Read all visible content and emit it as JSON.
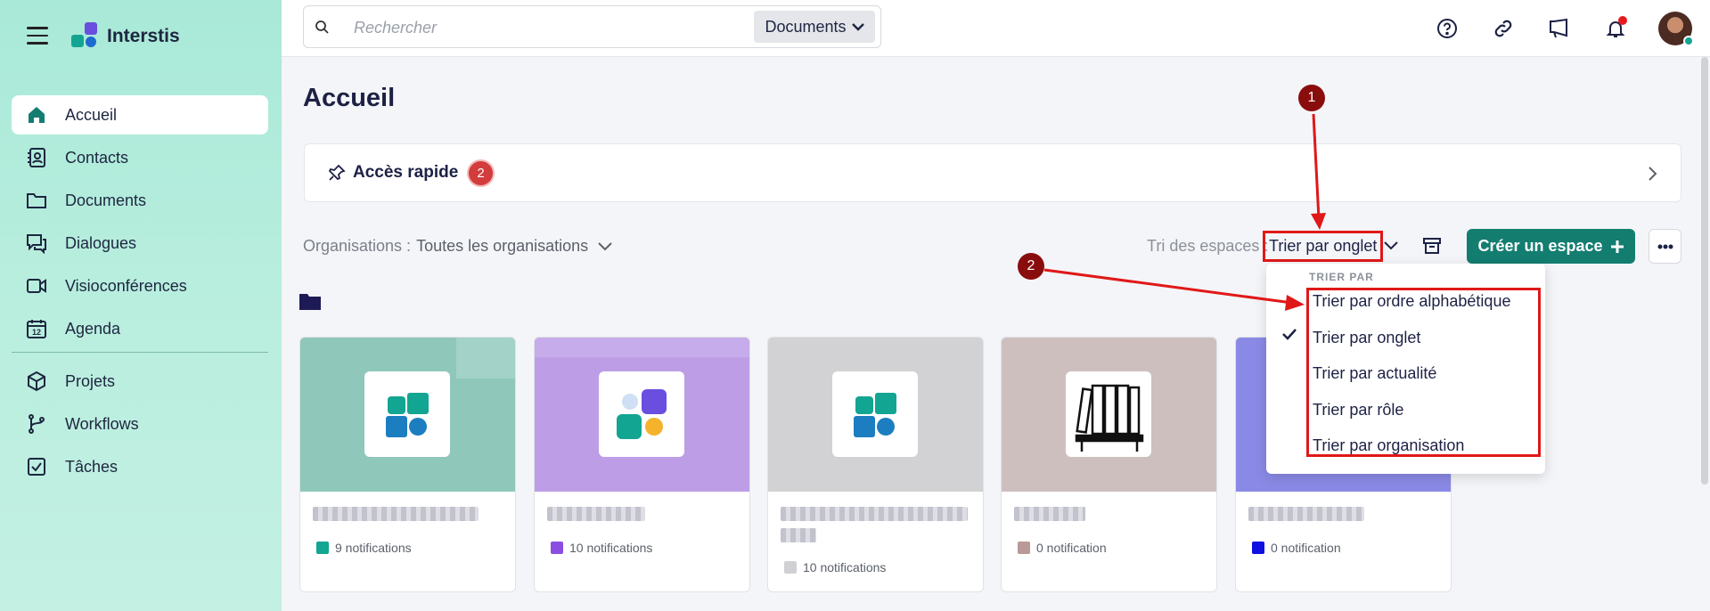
{
  "app": {
    "name": "Interstis"
  },
  "sidebar": {
    "items": [
      {
        "label": "Accueil",
        "icon": "home-icon"
      },
      {
        "label": "Contacts",
        "icon": "contacts-icon"
      },
      {
        "label": "Documents",
        "icon": "folder-icon"
      },
      {
        "label": "Dialogues",
        "icon": "chat-icon"
      },
      {
        "label": "Visioconférences",
        "icon": "video-icon"
      },
      {
        "label": "Agenda",
        "icon": "calendar-icon"
      },
      {
        "label": "Projets",
        "icon": "cube-icon"
      },
      {
        "label": "Workflows",
        "icon": "workflow-icon"
      },
      {
        "label": "Tâches",
        "icon": "checkbox-icon"
      }
    ],
    "calendar_day": "12"
  },
  "topbar": {
    "search_placeholder": "Rechercher",
    "search_scope": "Documents"
  },
  "main": {
    "title": "Accueil",
    "quick_access": {
      "label": "Accès rapide",
      "count": "2"
    },
    "org_filter": {
      "label": "Organisations :",
      "value": "Toutes les organisations"
    },
    "sort": {
      "label": "Tri des espaces :",
      "value": "Trier par onglet"
    },
    "create_button": "Créer un espace"
  },
  "dropdown": {
    "header": "TRIER PAR",
    "options": [
      "Trier par ordre alphabétique",
      "Trier par onglet",
      "Trier par actualité",
      "Trier par rôle",
      "Trier par organisation"
    ],
    "selected_index": 1
  },
  "annotations": {
    "m1": "1",
    "m2": "2"
  },
  "cards": [
    {
      "notifications": "9 notifications",
      "color": "#12a592",
      "cover": "#8fc7bb"
    },
    {
      "notifications": "10 notifications",
      "color": "#8a4ee0",
      "cover": "#bd9ee6"
    },
    {
      "notifications": "10 notifications",
      "color": "#d0d0d4",
      "cover": "#d2d2d4"
    },
    {
      "notifications": "0 notification",
      "color": "#b89a98",
      "cover": "#cebfbf"
    },
    {
      "notifications": "0 notification",
      "color": "#1010e0",
      "cover": "#8a8ae6"
    }
  ],
  "colors": {
    "accent": "#137d70",
    "annotation_red": "#e01818",
    "marker": "#8a0d0d"
  }
}
